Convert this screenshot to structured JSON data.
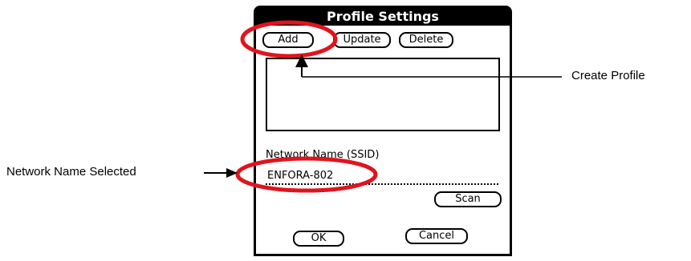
{
  "dialog": {
    "title": "Profile Settings",
    "buttons": {
      "add": "Add",
      "update": "Update",
      "delete": "Delete"
    },
    "network_name_label": "Network Name (SSID)",
    "network_name_value": "ENFORA-802",
    "scan": "Scan",
    "ok": "OK",
    "cancel": "Cancel"
  },
  "annotations": {
    "create_profile": "Create Profile",
    "network_name_selected": "Network Name Selected",
    "highlight_color": "#e0141e"
  }
}
